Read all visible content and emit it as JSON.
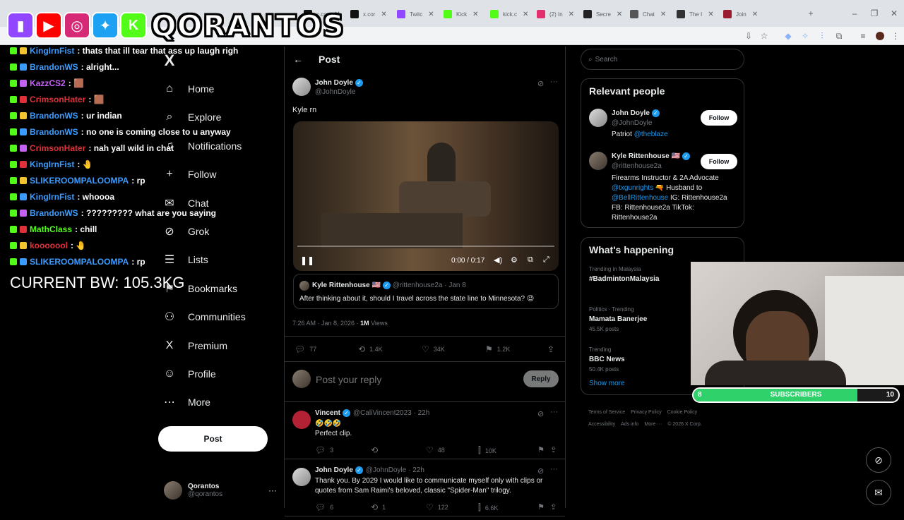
{
  "browser": {
    "tabs": [
      {
        "label": "x.cor",
        "color": "#111111"
      },
      {
        "label": "x.cor",
        "color": "#111111"
      },
      {
        "label": "Twitc",
        "color": "#9146ff"
      },
      {
        "label": "Kick",
        "color": "#53fc18"
      },
      {
        "label": "kick.c",
        "color": "#53fc18"
      },
      {
        "label": "(2) In",
        "color": "#e1306c"
      },
      {
        "label": "Secre",
        "color": "#222222"
      },
      {
        "label": "Chat",
        "color": "#555555"
      },
      {
        "label": "The I",
        "color": "#333333"
      },
      {
        "label": "Join",
        "color": "#9b1b30"
      }
    ]
  },
  "overlay": {
    "brand_name": "QORANTOS",
    "socials": [
      {
        "icon": "twitch-icon",
        "color": "#9146ff",
        "glyph": "▮"
      },
      {
        "icon": "youtube-icon",
        "color": "#ff0000",
        "glyph": "▶"
      },
      {
        "icon": "instagram-icon",
        "color": "#d62976",
        "glyph": "◎"
      },
      {
        "icon": "twitter-bird-icon",
        "color": "#1da1f2",
        "glyph": "✦"
      },
      {
        "icon": "kick-icon",
        "color": "#53fc18",
        "glyph": "K"
      }
    ],
    "body_weight": "CURRENT BW: 105.3KG",
    "chat": [
      {
        "user": "KingIrnFist",
        "color": "#3b9cff",
        "msg": ": thats that ill tear that ass up laugh righ"
      },
      {
        "user": "BrandonWS",
        "color": "#3b9cff",
        "msg": ": alright..."
      },
      {
        "user": "KazzCS2",
        "color": "#c561f5",
        "msg": ": 🟫"
      },
      {
        "user": "CrimsonHater",
        "color": "#e0303a",
        "msg": ": 🟫"
      },
      {
        "user": "BrandonWS",
        "color": "#3b9cff",
        "msg": ": ur indian"
      },
      {
        "user": "BrandonWS",
        "color": "#3b9cff",
        "msg": ": no one is coming close to u anyway"
      },
      {
        "user": "CrimsonHater",
        "color": "#e0303a",
        "msg": ": nah yall wild in chat"
      },
      {
        "user": "KingIrnFist",
        "color": "#3b9cff",
        "msg": ": 🤚"
      },
      {
        "user": "SLIKEROOMPALOOMPA",
        "color": "#3b9cff",
        "msg": ": rp"
      },
      {
        "user": "KingIrnFist",
        "color": "#3b9cff",
        "msg": ": whoooa"
      },
      {
        "user": "BrandonWS",
        "color": "#3b9cff",
        "msg": ": ????????? what are you saying"
      },
      {
        "user": "MathClass",
        "color": "#53fc18",
        "msg": ": chill"
      },
      {
        "user": "kooooool",
        "color": "#e0303a",
        "msg": ": 🤚"
      },
      {
        "user": "SLIKEROOMPALOOMPA",
        "color": "#3b9cff",
        "msg": ": rp"
      }
    ],
    "subscribers": {
      "label": "SUBSCRIBERS",
      "current": "8",
      "goal": "10",
      "progress": 0.8
    }
  },
  "nav": {
    "items": [
      {
        "label": "Home",
        "icon": "home-icon",
        "glyph": "⌂"
      },
      {
        "label": "Explore",
        "icon": "search-icon",
        "glyph": "⌕"
      },
      {
        "label": "Notifications",
        "icon": "bell-icon",
        "glyph": "♫"
      },
      {
        "label": "Follow",
        "icon": "follow-icon",
        "glyph": "+"
      },
      {
        "label": "Chat",
        "icon": "chat-icon",
        "glyph": "✉"
      },
      {
        "label": "Grok",
        "icon": "grok-icon",
        "glyph": "⊘"
      },
      {
        "label": "Lists",
        "icon": "lists-icon",
        "glyph": "☰"
      },
      {
        "label": "Bookmarks",
        "icon": "bookmark-icon",
        "glyph": "⚑"
      },
      {
        "label": "Communities",
        "icon": "communities-icon",
        "glyph": "⚇"
      },
      {
        "label": "Premium",
        "icon": "x-logo-icon",
        "glyph": "X"
      },
      {
        "label": "Profile",
        "icon": "profile-icon",
        "glyph": "☺"
      },
      {
        "label": "More",
        "icon": "more-circle-icon",
        "glyph": "⋯"
      }
    ],
    "post_label": "Post",
    "account": {
      "name": "Qorantos",
      "handle": "@qorantos"
    }
  },
  "post": {
    "header": "Post",
    "author": "John Doyle",
    "handle": "@JohnDoyle",
    "text": "Kyle rn",
    "video_time": "0:00 / 0:17",
    "video_progress": 0.0,
    "quote": {
      "author": "Kyle Rittenhouse 🇺🇸",
      "handle": "@rittenhouse2a",
      "date": "· Jan 8",
      "text": "After thinking about it, should I travel across the state line to Minnesota? 😉"
    },
    "timestamp": "7:26 AM · Jan 8, 2026 · ",
    "views_count": "1M",
    "views_label": " Views",
    "replies": "77",
    "reposts": "1.4K",
    "likes": "34K",
    "bookmarks": "1.2K",
    "reply_placeholder": "Post your reply",
    "reply_button": "Reply"
  },
  "replies": [
    {
      "author": "Vincent",
      "handle": "@CaliVincent2023 · 22h",
      "line1": "🤣🤣🤣",
      "line2": "Perfect clip.",
      "replies": "3",
      "likes": "48",
      "views": "10K"
    },
    {
      "author": "John Doyle",
      "handle": "@JohnDoyle · 22h",
      "line1": "Thank you. By 2029 I would like to communicate myself only with clips or",
      "line2": "quotes from Sam Raimi's beloved, classic \"Spider-Man\" trilogy.",
      "replies": "6",
      "reposts": "1",
      "likes": "122",
      "views": "6.6K"
    }
  ],
  "sidebar": {
    "search_placeholder": "Search",
    "relevant_title": "Relevant people",
    "people": [
      {
        "name": "John Doyle",
        "handle": "@JohnDoyle",
        "bio1": "Patriot ",
        "bio_link": "@theblaze",
        "follow": "Follow"
      },
      {
        "name": "Kyle Rittenhouse 🇺🇸",
        "handle": "@rittenhouse2a",
        "bio_lines": [
          "Firearms Instructor & 2A Advocate",
          "@txgunrights 🔫 Husband to",
          "@BellRittenhouse IG: Rittenhouse2a",
          "FB: Rittenhouse2a TikTok:",
          "Rittenhouse2a"
        ],
        "follow": "Follow"
      }
    ],
    "happening_title": "What's happening",
    "trends": [
      {
        "context": "Trending in Malaysia",
        "name": "#BadmintonMalaysia",
        "posts": ""
      },
      {
        "context": "Politics · Trending",
        "name": "Mamata Banerjee",
        "posts": "45.5K posts"
      },
      {
        "context": "Trending",
        "name": "BBC News",
        "posts": "50.4K posts"
      }
    ],
    "show_more": "Show more",
    "footer1": [
      "Terms of Service",
      "Privacy Policy",
      "Cookie Policy"
    ],
    "footer2": [
      "Accessibility",
      "Ads info",
      "More ···",
      "© 2026 X Corp."
    ]
  }
}
